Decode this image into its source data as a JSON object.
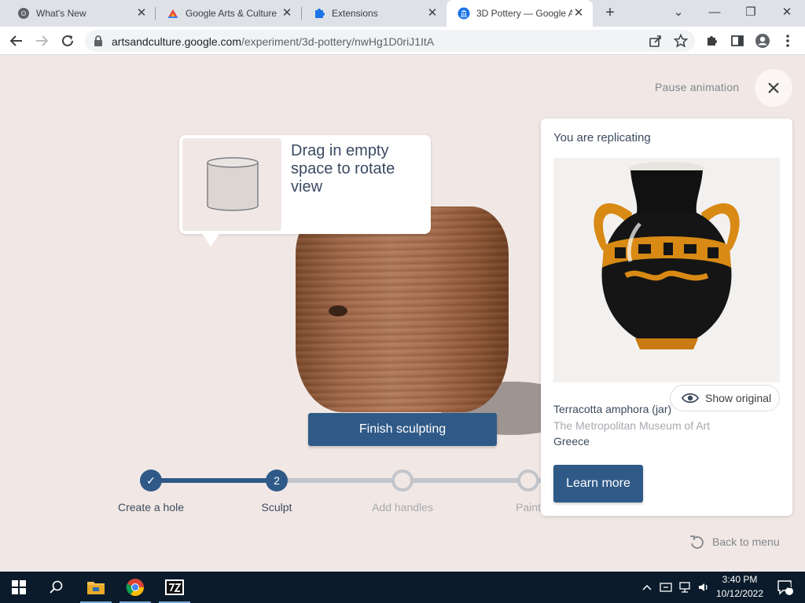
{
  "browser": {
    "tabs": [
      {
        "title": "What's New",
        "icon": "chrome-icon",
        "active": false
      },
      {
        "title": "Google Arts & Culture",
        "icon": "arts-culture-icon",
        "active": false
      },
      {
        "title": "Extensions",
        "icon": "puzzle-icon",
        "active": false
      },
      {
        "title": "3D Pottery — Google A",
        "icon": "museum-icon",
        "active": true
      }
    ],
    "new_tab": "+",
    "url": {
      "host": "artsandculture.google.com",
      "path": "/experiment/3d-pottery/nwHg1D0riJ1ItA"
    }
  },
  "page": {
    "pause_link": "Pause animation",
    "tooltip_text": "Drag in empty space to rotate view",
    "finish_button": "Finish sculpting",
    "steps": [
      {
        "label": "Create a hole",
        "marker": "✓",
        "state": "done"
      },
      {
        "label": "Sculpt",
        "marker": "2",
        "state": "current"
      },
      {
        "label": "Add handles",
        "marker": "",
        "state": "todo"
      },
      {
        "label": "Paint",
        "marker": "",
        "state": "todo"
      }
    ],
    "card": {
      "heading": "You are replicating",
      "show_original": "Show original",
      "artwork_title": "Terracotta amphora (jar)",
      "museum": "The Metropolitan Museum of Art",
      "place": "Greece",
      "learn_more": "Learn more"
    },
    "back_to_menu": "Back to menu"
  },
  "taskbar": {
    "time": "3:40 PM",
    "date": "10/12/2022",
    "notification_count": "1"
  },
  "colors": {
    "accent": "#2f5a88",
    "page_bg": "#f1e8e5",
    "taskbar": "#0b1b2b"
  }
}
